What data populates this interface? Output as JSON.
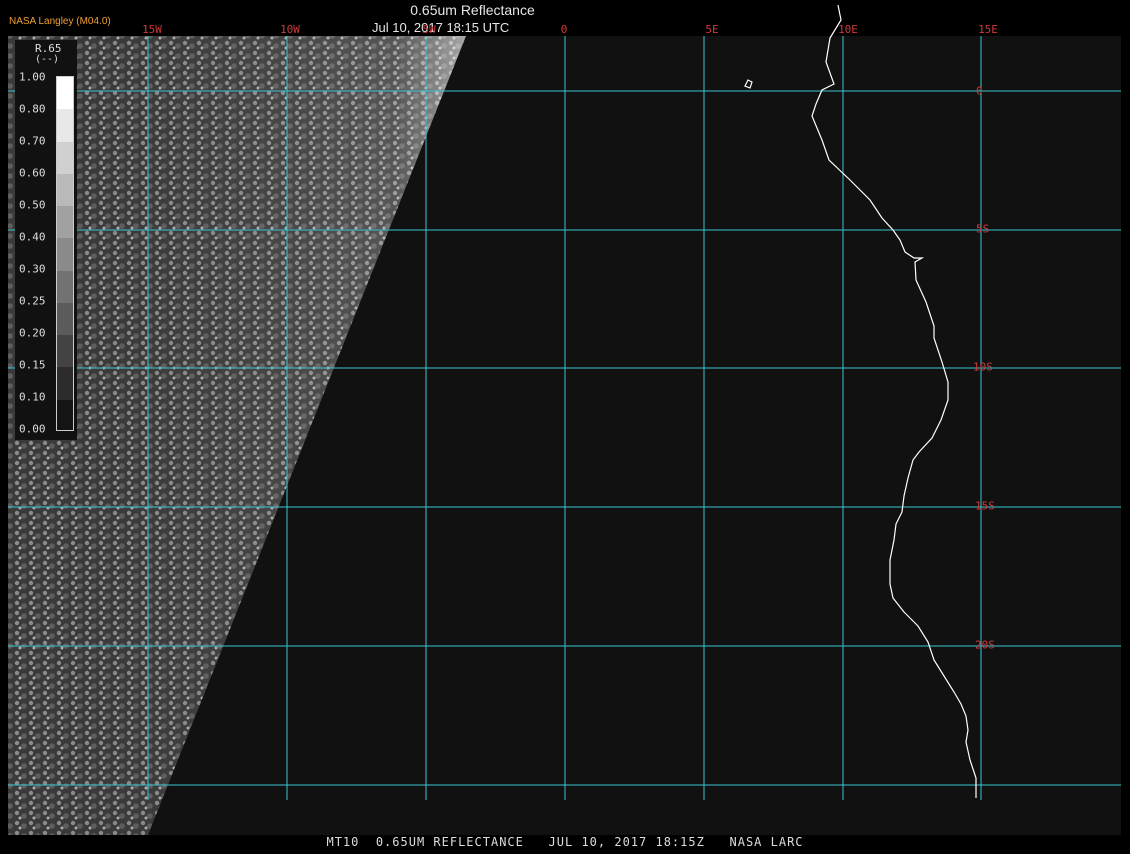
{
  "header": {
    "organization": "NASA Langley (M04.0)",
    "title": "0.65um Reflectance",
    "datetime": "Jul 10, 2017 18:15 UTC"
  },
  "footer": {
    "caption": "MT10  0.65UM REFLECTANCE   JUL 10, 2017 18:15Z   NASA LARC"
  },
  "map": {
    "longitude_labels": [
      "15W",
      "10W",
      "5W",
      "0",
      "5E",
      "10E",
      "15E"
    ],
    "latitude_labels": [
      "0",
      "5S",
      "10S",
      "15S",
      "20S"
    ],
    "grid_color": "#39c6cf",
    "label_color": "#d03a3a",
    "coastline_color": "#ffffff",
    "background_color": "#111111"
  },
  "legend": {
    "title": "R.65",
    "unit": "(--)",
    "ticks": [
      "1.00",
      "0.80",
      "0.70",
      "0.60",
      "0.50",
      "0.40",
      "0.30",
      "0.25",
      "0.20",
      "0.15",
      "0.10",
      "0.00"
    ]
  }
}
